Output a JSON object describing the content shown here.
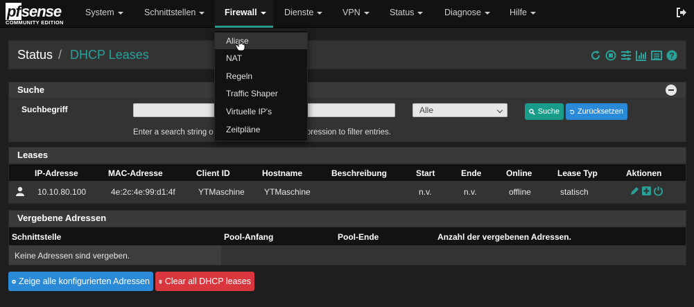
{
  "brand": {
    "logo_text": "pfsense",
    "edition": "COMMUNITY EDITION"
  },
  "nav": {
    "items": [
      {
        "label": "System"
      },
      {
        "label": "Schnittstellen"
      },
      {
        "label": "Firewall",
        "active": true
      },
      {
        "label": "Dienste"
      },
      {
        "label": "VPN"
      },
      {
        "label": "Status"
      },
      {
        "label": "Diagnose"
      },
      {
        "label": "Hilfe"
      }
    ]
  },
  "firewall_menu": {
    "items": [
      "Aliase",
      "NAT",
      "Regeln",
      "Traffic Shaper",
      "Virtuelle IP's",
      "Zeitpläne"
    ],
    "hovered": "Aliase"
  },
  "breadcrumb": {
    "section": "Status",
    "separator": "/",
    "page": "DHCP Leases"
  },
  "header_icons": [
    "refresh-icon",
    "stop-icon",
    "settings-sliders-icon",
    "chart-icon",
    "list-icon",
    "help-icon"
  ],
  "search": {
    "title": "Suche",
    "term_label": "Suchbegriff",
    "term_value": "",
    "filter_selected": "Alle",
    "search_button": "Suche",
    "reset_button": "Zurücksetzen",
    "help_text_prefix": "Enter a search string o",
    "help_text_suffix": "expression to filter entries."
  },
  "leases": {
    "title": "Leases",
    "columns": [
      "IP-Adresse",
      "MAC-Adresse",
      "Client ID",
      "Hostname",
      "Beschreibung",
      "Start",
      "Ende",
      "Online",
      "Lease Typ",
      "Aktionen"
    ],
    "rows": [
      {
        "ip": "10.10.80.100",
        "mac": "4e:2c:4e:99:d1:4f",
        "client_id": "YTMaschine",
        "hostname": "YTMaschine",
        "description": "",
        "start": "n.v.",
        "end": "n.v.",
        "online": "offline",
        "lease_type": "statisch"
      }
    ]
  },
  "assigned": {
    "title": "Vergebene Adressen",
    "columns": [
      "Schnittstelle",
      "Pool-Anfang",
      "Pool-Ende",
      "Anzahl der vergebenen Adressen."
    ],
    "empty_message": "Keine Adressen sind vergeben."
  },
  "actions": {
    "show_all": "Zeige alle konfigurierten Adressen",
    "clear_all": "Clear all DHCP leases"
  },
  "colors": {
    "accent": "#2aa198",
    "primary_button": "#2b8ad8",
    "success_button": "#1a9c8a",
    "danger_button": "#d9363e"
  }
}
